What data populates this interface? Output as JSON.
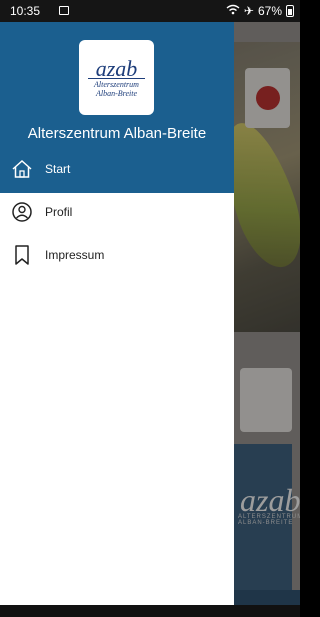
{
  "status_bar": {
    "time": "10:35",
    "battery": "67%"
  },
  "drawer": {
    "logo": {
      "main": "azab",
      "sub1": "Alterszentrum",
      "sub2": "Alban-Breite"
    },
    "title": "Alterszentrum Alban-Breite",
    "items": [
      {
        "label": "Start",
        "icon": "home-icon",
        "active": true
      },
      {
        "label": "Profil",
        "icon": "user-circle-icon",
        "active": false
      },
      {
        "label": "Impressum",
        "icon": "bookmark-icon",
        "active": false
      }
    ]
  },
  "background": {
    "card_logo": "azab",
    "card_sub": "ALTERSZENTRUM ALBAN-BREITE"
  },
  "colors": {
    "header": "#1b5f8f",
    "logo": "#1d3d7a",
    "profile_accent": "#b0302f"
  }
}
